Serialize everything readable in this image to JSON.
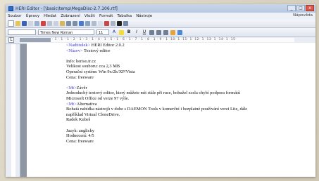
{
  "window": {
    "title": "HERI Editor - [\\basic\\temp\\MegaDisc-2.7.106.rtf]",
    "minimize": "_",
    "maximize": "□",
    "close": "x"
  },
  "menu": {
    "items": [
      "Soubor",
      "Úpravy",
      "Hledat",
      "Zobrazení",
      "Vložit",
      "Formát",
      "Tabulka",
      "Nástroje"
    ],
    "right": "Nápověda"
  },
  "toolbar": {
    "font_name": "Times New Roman",
    "font_size": "11",
    "bold": "B",
    "italic": "I",
    "underline": "U"
  },
  "ruler": {
    "text": "· 1 · 1 · 1 · 2 · 1 · 3 · 1 · 4 · 1 · 5 · 1 · 6 · 1 · 7 · 1 · 8 · 1 · 9 · 1 ·10· 1 ·11· 1 ·12· 1 ·13· 1 ·14· 1 ·15·",
    "tab_marker": "L"
  },
  "document": {
    "lines": [
      {
        "tag": "<Nadtitulek>",
        "text": " HERI Editor 2.0.2"
      },
      {
        "tag": "<Název>",
        "text": " Textový editor"
      },
      {
        "tag": "",
        "text": ""
      },
      {
        "tag": "",
        "text": "Info: heriso.tr.cz"
      },
      {
        "tag": "",
        "text": "Velikost souboru: cca 2,3 MB"
      },
      {
        "tag": "",
        "text": "Operační systém: Win 9x/2k/XP/Vista"
      },
      {
        "tag": "",
        "text": "Cena: freeware"
      },
      {
        "tag": "",
        "text": ""
      },
      {
        "tag": "<Mt>",
        "text": "Závěr"
      },
      {
        "tag": "",
        "text": "Jednoduchý textový editor, který můžete mít stále při ruce, bohužel zcela chybí podpora formátů"
      },
      {
        "tag": "",
        "text": "Microsoft Office od verze 97 výše."
      },
      {
        "tag": "<Mt>",
        "text": "Alternativa"
      },
      {
        "tag": "",
        "text": "Bohatá nabídka nástrojů v dobe s DAEMON Tools v komerční i bezplatné používání verzi Lite, dále"
      },
      {
        "tag": "",
        "text": "například Virtual CloneDrive."
      },
      {
        "tag": "",
        "text": "Radek Kubeš"
      },
      {
        "tag": "",
        "text": ""
      },
      {
        "tag": "",
        "text": "Jazyk: anglicky"
      },
      {
        "tag": "",
        "text": "Hodnocení: 4/5"
      },
      {
        "tag": "",
        "text": "Cena: freeware"
      }
    ]
  }
}
